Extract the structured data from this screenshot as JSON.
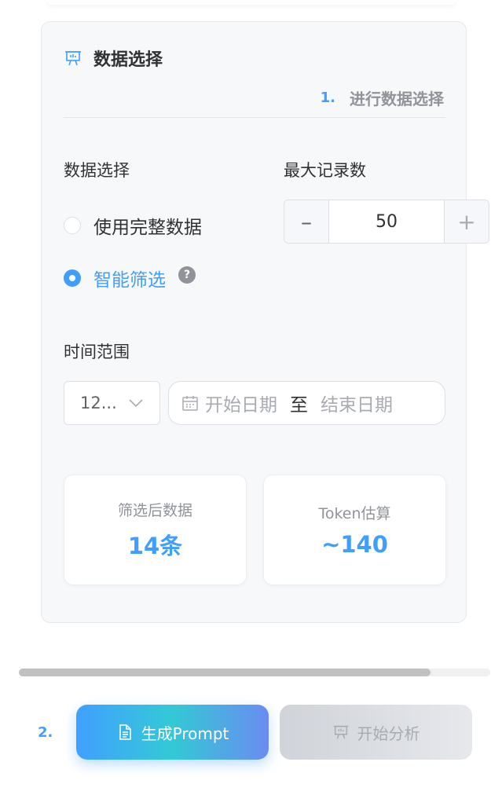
{
  "card": {
    "title": "数据选择",
    "title_icon": "presentation-icon",
    "step": {
      "number": "1.",
      "text": "进行数据选择"
    }
  },
  "data_select": {
    "label": "数据选择",
    "options": [
      {
        "label": "使用完整数据",
        "checked": false
      },
      {
        "label": "智能筛选",
        "checked": true
      }
    ],
    "help_icon": "question-icon",
    "help_glyph": "?"
  },
  "max_records": {
    "label": "最大记录数",
    "value": "50",
    "minus_glyph": "–",
    "plus_glyph": "+"
  },
  "time_range": {
    "label": "时间范围",
    "select_value": "12...",
    "start_placeholder": "开始日期",
    "separator": "至",
    "end_placeholder": "结束日期"
  },
  "stats": {
    "filtered": {
      "label": "筛选后数据",
      "value": "14条"
    },
    "token": {
      "label": "Token估算",
      "value": "~140"
    }
  },
  "scrollbar": {
    "position": 0.87
  },
  "actions": {
    "step_number": "2.",
    "generate_label": "生成Prompt",
    "analyze_label": "开始分析"
  },
  "colors": {
    "accent": "#409eff",
    "card_bg": "#f7f8fa",
    "text": "#303133",
    "muted": "#909399"
  }
}
